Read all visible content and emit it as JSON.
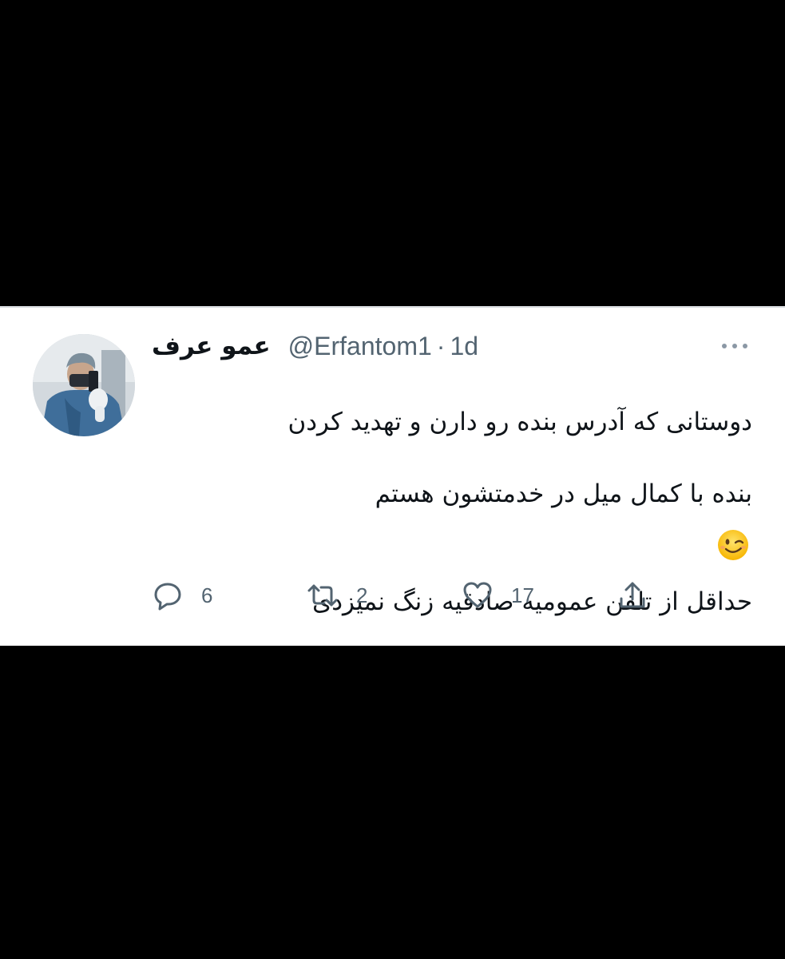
{
  "tweet": {
    "author": {
      "display_name": "عمو عرف",
      "handle": "@Erfantom1",
      "separator": "·",
      "time": "1d"
    },
    "text_lines_para1": [
      "دوستانی که آدرس بنده رو دارن و تهدید کردن",
      "بنده با کمال میل در خدمتشون هستم"
    ],
    "text_line_para2": "حداقل از تلفن عمومیه صادقیه  زنگ نمیزدی",
    "emoji": "winking-face",
    "actions": {
      "reply_count": "6",
      "retweet_count": "2",
      "like_count": "17"
    }
  },
  "icons": {
    "more": "more-horizontal-icon",
    "reply": "reply-icon",
    "retweet": "retweet-icon",
    "like": "heart-icon",
    "share": "share-icon"
  },
  "colors": {
    "background": "#000000",
    "card": "#ffffff",
    "text": "#0f1419",
    "secondary": "#536471"
  }
}
